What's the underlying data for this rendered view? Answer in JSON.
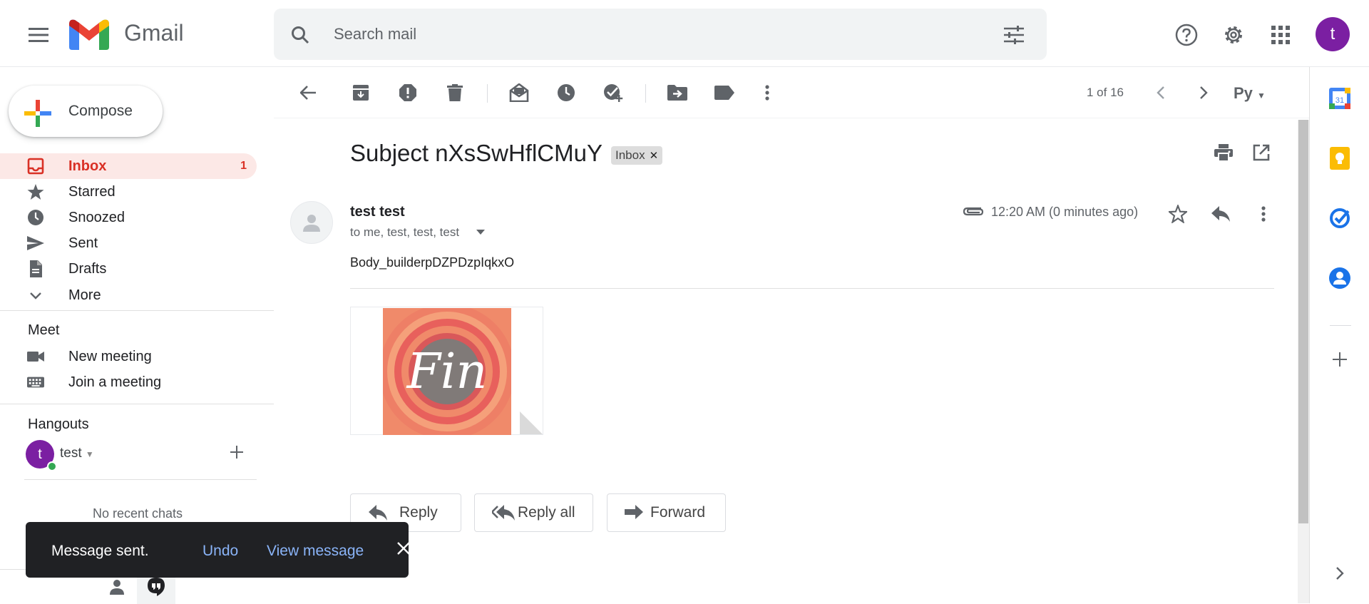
{
  "app": {
    "name": "Gmail",
    "search_placeholder": "Search mail"
  },
  "header": {
    "avatar_letter": "t",
    "icons": [
      "menu-icon",
      "search-icon",
      "tune-icon",
      "help-icon",
      "settings-icon",
      "apps-icon"
    ]
  },
  "nav": {
    "compose_label": "Compose",
    "items": [
      {
        "label": "Inbox",
        "count": "1",
        "icon": "inbox-icon",
        "active": true
      },
      {
        "label": "Starred",
        "icon": "star-icon"
      },
      {
        "label": "Snoozed",
        "icon": "clock-icon"
      },
      {
        "label": "Sent",
        "icon": "send-icon"
      },
      {
        "label": "Drafts",
        "icon": "draft-icon"
      },
      {
        "label": "More",
        "icon": "chevron-down-icon"
      }
    ],
    "meet": {
      "title": "Meet",
      "new_meeting": "New meeting",
      "join_meeting": "Join a meeting"
    },
    "hangouts": {
      "title": "Hangouts",
      "user_letter": "t",
      "user_name": "test",
      "no_chats": "No recent chats"
    }
  },
  "toolbar": {
    "pager": "1 of 16",
    "lang": "Pу"
  },
  "email": {
    "subject": "Subject nXsSwHflCMuY",
    "label_badge": "Inbox",
    "sender": "test test",
    "recipients": "to me, test, test, test",
    "time": "12:20 AM (0 minutes ago)",
    "body": "Body_builderpDZPDzpIqkxO",
    "attachment_text": "Fin",
    "reply_label": "Reply",
    "reply_all_label": "Reply all",
    "forward_label": "Forward"
  },
  "toast": {
    "message": "Message sent.",
    "undo": "Undo",
    "view": "View message"
  },
  "side_panel": {
    "calendar_day": "31"
  },
  "colors": {
    "accent_red": "#d93025",
    "active_bg": "#fce8e6",
    "avatar_purple": "#7b1fa2",
    "toast_bg": "#202124",
    "toast_link": "#8ab4f8"
  }
}
